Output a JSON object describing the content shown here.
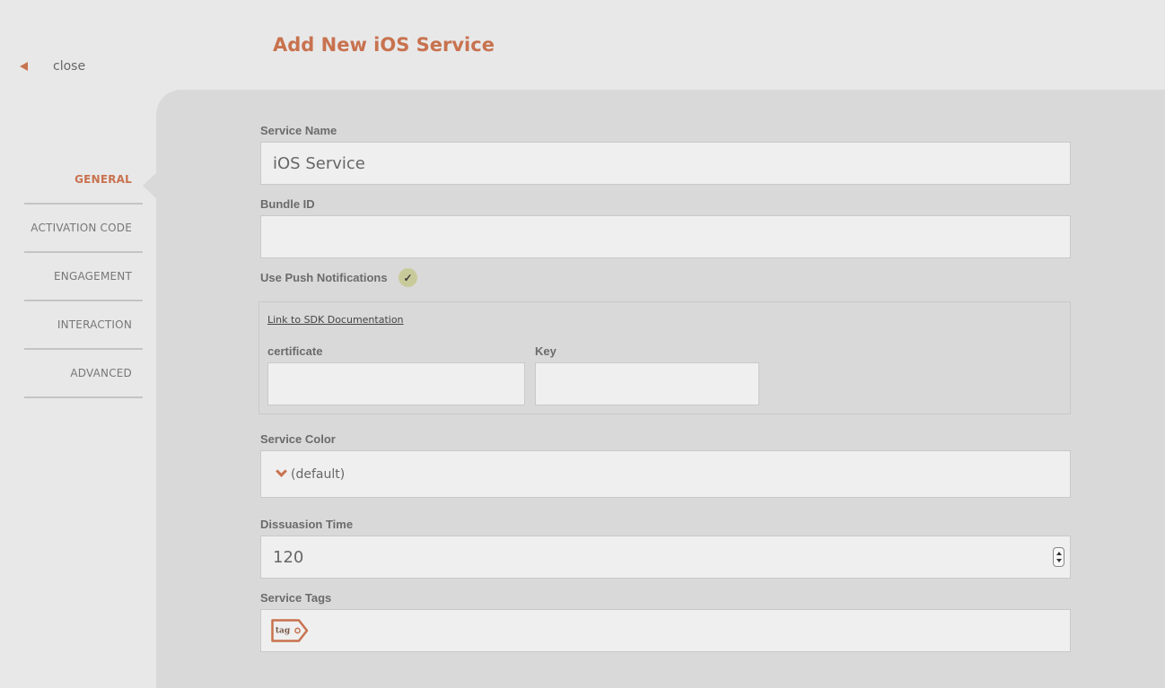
{
  "header": {
    "title": "Add New iOS Service",
    "close_label": "close"
  },
  "nav": {
    "items": [
      {
        "label": "GENERAL",
        "active": true
      },
      {
        "label": "ACTIVATION CODE",
        "active": false
      },
      {
        "label": "ENGAGEMENT",
        "active": false
      },
      {
        "label": "INTERACTION",
        "active": false
      },
      {
        "label": "ADVANCED",
        "active": false
      }
    ]
  },
  "form": {
    "service_name": {
      "label": "Service Name",
      "value": "iOS Service"
    },
    "bundle_id": {
      "label": "Bundle ID",
      "value": ""
    },
    "push": {
      "label": "Use Push Notifications",
      "checked": true,
      "check_glyph": "✓",
      "sdk_link": "Link to SDK Documentation",
      "certificate_label": "certificate",
      "certificate_value": "",
      "key_label": "Key",
      "key_value": ""
    },
    "service_color": {
      "label": "Service Color",
      "value": "(default)"
    },
    "dissuasion_time": {
      "label": "Dissuasion Time",
      "value": "120"
    },
    "service_tags": {
      "label": "Service Tags",
      "tag_icon_text": "tag"
    }
  },
  "colors": {
    "accent": "#c8724f",
    "panel": "#d9d9d9",
    "background": "#e8e8e8",
    "checkbox": "#c9ca9a"
  },
  "icons": {
    "close": "back-triangle-icon",
    "check": "checkmark-icon",
    "select": "chevron-down-icon",
    "spinner": "spinner-arrows-icon",
    "tag": "tag-icon"
  }
}
